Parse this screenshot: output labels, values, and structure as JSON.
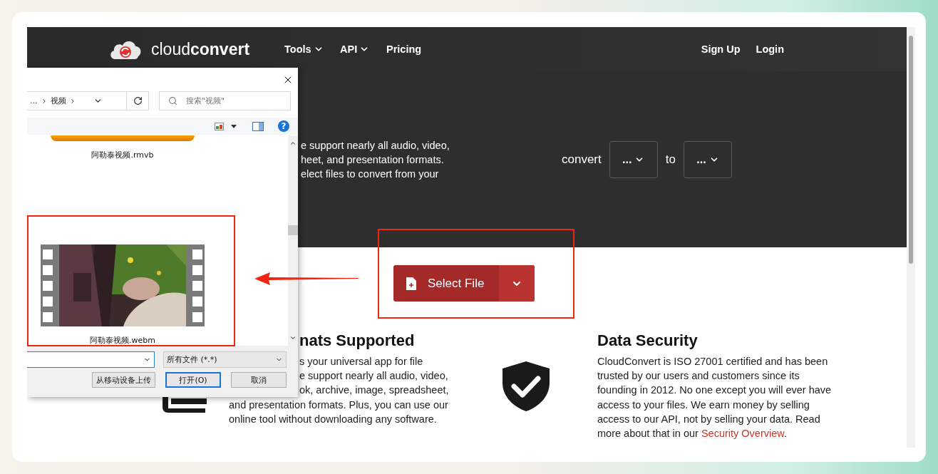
{
  "site": {
    "logo_light": "cloud",
    "logo_bold": "convert",
    "nav": [
      {
        "label": "Tools",
        "dropdown": true
      },
      {
        "label": "API",
        "dropdown": true
      },
      {
        "label": "Pricing",
        "dropdown": false
      }
    ],
    "auth": [
      "Sign Up",
      "Login"
    ]
  },
  "hero": {
    "lines": [
      "e support nearly all audio, video,",
      "heet, and presentation formats.",
      "elect files to convert from your"
    ],
    "convert_label": "convert",
    "from_value": "...",
    "to_label": "to",
    "to_value": "..."
  },
  "select_button": {
    "label": "Select File"
  },
  "formats": {
    "heading": "nats Supported",
    "lines": [
      {
        "text": "s your universal app for file",
        "cut": true
      },
      {
        "text": "e support nearly all audio, video,",
        "cut": true
      },
      {
        "text": "ok, archive, image, spreadsheet,",
        "cut": true
      },
      {
        "text": "and presentation formats. Plus, you can use our",
        "cut": false
      },
      {
        "text": "online tool without downloading any software.",
        "cut": false
      }
    ]
  },
  "security": {
    "heading": "Data Security",
    "text": "CloudConvert is ISO 27001 certified and has been trusted by our users and customers since its founding in 2012. No one except you will ever have access to your files. We earn money by selling access to our API, not by selling your data. Read more about that in our ",
    "link": "Security Overview",
    "end": "."
  },
  "dialog": {
    "breadcrumb": [
      "...",
      "视频"
    ],
    "search_placeholder": "搜索\"视频\"",
    "help": "?",
    "files": [
      {
        "name": "阿勒泰视频.rmvb",
        "kind": "cut"
      },
      {
        "name": "阿勒泰视频.webm",
        "kind": "video"
      }
    ],
    "filter": "所有文件 (*.*)",
    "buttons": [
      {
        "label": "从移动设备上传",
        "default": false
      },
      {
        "label": "打开(O)",
        "default": true
      },
      {
        "label": "取消",
        "default": false
      }
    ]
  }
}
